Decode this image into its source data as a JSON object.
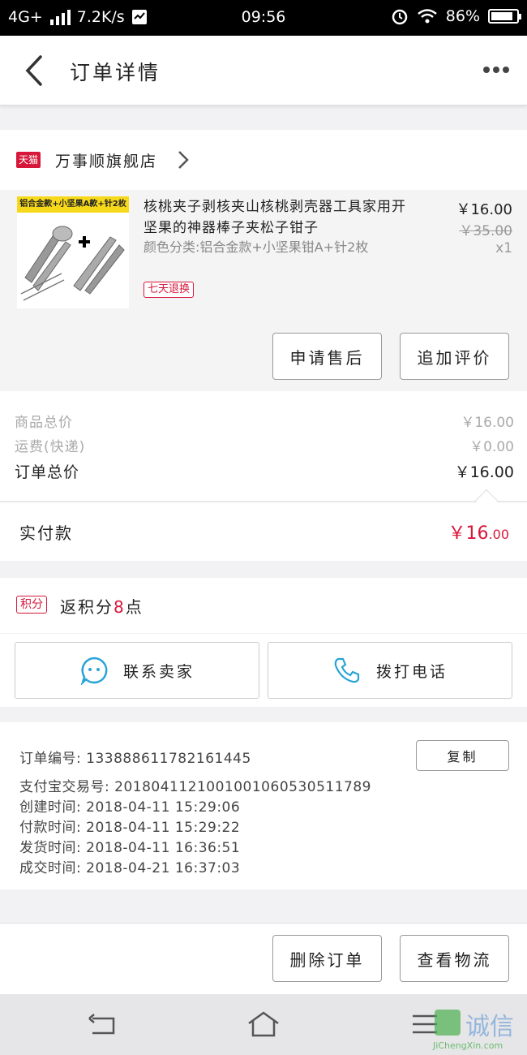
{
  "status": {
    "network": "4G+",
    "speed": "7.2K/s",
    "time": "09:56",
    "battery": "86%",
    "battery_level": 0.86
  },
  "nav": {
    "title": "订单详情"
  },
  "shop": {
    "badge": "天猫",
    "name": "万事顺旗舰店"
  },
  "product": {
    "image_tag": "铝合金款+小坚果A款+针2枚",
    "title": "核桃夹子剥核夹山核桃剥壳器工具家用开坚果的神器棒子夹松子钳子",
    "spec": "颜色分类:铝合金款+小坚果钳A+针2枚",
    "badge": "七天退换",
    "price": "￥16.00",
    "original_price": "￥35.00",
    "qty": "x1",
    "buttons": {
      "after_sale": "申请售后",
      "add_review": "追加评价"
    }
  },
  "totals": [
    {
      "label": "商品总价",
      "value": "￥16.00"
    },
    {
      "label": "运费(快递)",
      "value": "￥0.00"
    },
    {
      "label": "订单总价",
      "value": "￥16.00"
    }
  ],
  "paid": {
    "label": "实付款",
    "value_main": "￥16",
    "value_dec": ".00"
  },
  "points": {
    "badge": "积分",
    "prefix": "返积分",
    "count": "8",
    "suffix": "点"
  },
  "contact": {
    "seller": "联系卖家",
    "call": "拨打电话"
  },
  "order_info": {
    "copy_label": "复制",
    "rows": [
      "订单编号: 133888611782161445",
      "支付宝交易号: 2018041121001001060530511789",
      "创建时间: 2018-04-11 15:29:06",
      "付款时间: 2018-04-11 15:29:22",
      "发货时间: 2018-04-11 16:36:51",
      "成交时间: 2018-04-21 16:37:03"
    ]
  },
  "bottom": {
    "delete": "删除订单",
    "logistics": "查看物流"
  },
  "watermark": {
    "text": "诚信",
    "url": "JiChengXin.com"
  },
  "colors": {
    "accent": "#d6173a",
    "blue_icon": "#2aa3d8"
  }
}
